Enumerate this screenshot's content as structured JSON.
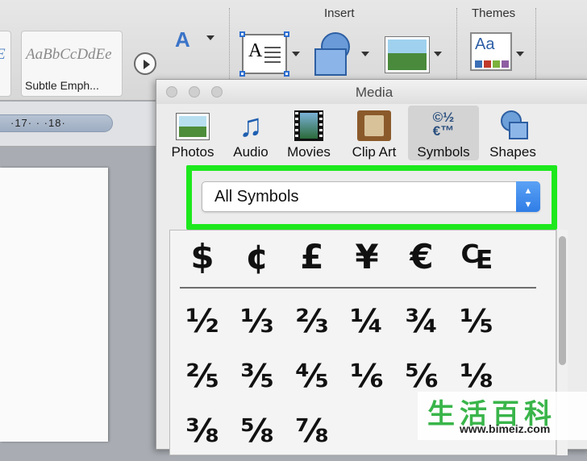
{
  "ribbon": {
    "partial_style_preview": "E",
    "styles": [
      {
        "preview": "AaBbCcDdEe",
        "name": "Subtle Emph..."
      }
    ],
    "groups": {
      "insert_label": "Insert",
      "themes_label": "Themes"
    },
    "icons": [
      "font-effects-icon",
      "text-box-icon",
      "shape-icon",
      "picture-icon",
      "themes-icon"
    ],
    "textbox_glyph": "A",
    "themes_glyph": "Aa",
    "theme_swatches": [
      "#3b6fb6",
      "#c0392b",
      "#7bb13c",
      "#8e5ea2"
    ]
  },
  "document": {
    "ruler_text": "·17· · ·18·"
  },
  "media_window": {
    "title": "Media",
    "tabs": [
      {
        "label": "Photos",
        "icon": "photos-icon"
      },
      {
        "label": "Audio",
        "icon": "audio-icon",
        "glyph": "♫"
      },
      {
        "label": "Movies",
        "icon": "movies-icon"
      },
      {
        "label": "Clip Art",
        "icon": "clip-art-icon"
      },
      {
        "label": "Symbols",
        "icon": "symbols-icon",
        "glyph_top": "©½",
        "glyph_bottom": "€™",
        "selected": true
      },
      {
        "label": "Shapes",
        "icon": "shapes-icon"
      }
    ],
    "category_select": {
      "value": "All Symbols",
      "stepper_up": "▲",
      "stepper_down": "▼"
    },
    "highlight_color": "#1de81d",
    "symbols": {
      "currency": [
        "$",
        "¢",
        "£",
        "¥",
        "€",
        "₠"
      ],
      "fractions_row1": [
        "½",
        "⅓",
        "⅔",
        "¼",
        "¾",
        "⅕"
      ],
      "fractions_row2": [
        "⅖",
        "⅗",
        "⅘",
        "⅙",
        "⅚",
        "⅛"
      ],
      "fractions_row3": [
        "⅜",
        "⅝",
        "⅞"
      ]
    }
  },
  "watermark": {
    "chinese": "生活百科",
    "url": "www.bimeiz.com"
  }
}
